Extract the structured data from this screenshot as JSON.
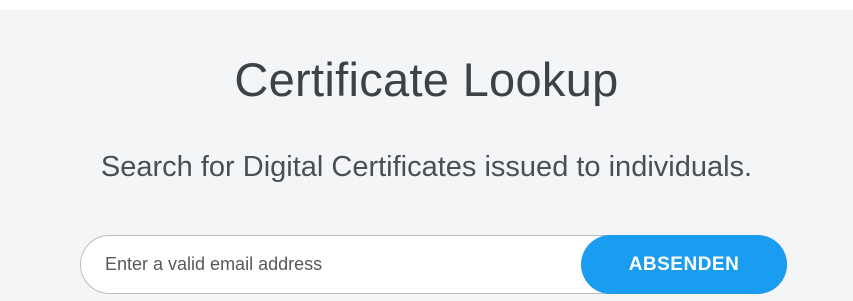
{
  "header": {
    "title": "Certificate Lookup",
    "subtitle": "Search for Digital Certificates issued to individuals."
  },
  "search": {
    "placeholder": "Enter a valid email address",
    "value": "",
    "submit_label": "ABSENDEN"
  },
  "colors": {
    "background": "#f4f5f7",
    "accent": "#1a9df0",
    "text": "#3d4248"
  }
}
